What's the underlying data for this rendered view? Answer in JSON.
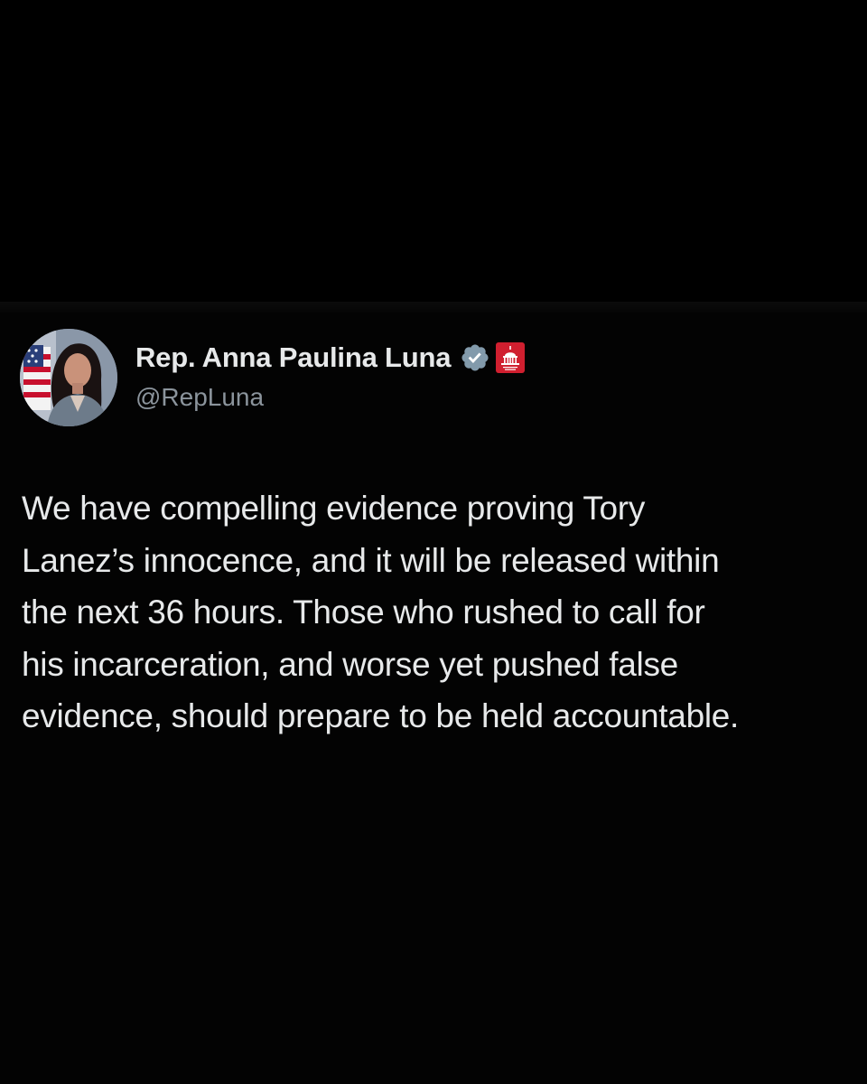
{
  "tweet": {
    "author": {
      "display_name": "Rep. Anna Paulina Luna",
      "handle": "@RepLuna",
      "verified_icon": "verified-badge-icon",
      "affiliation_icon": "capitol-icon",
      "avatar": "profile-photo"
    },
    "text": "We have compelling evidence proving Tory\nLanez’s innocence, and it will be released within\nthe next 36 hours. Those who rushed to call for\nhis incarceration, and worse yet pushed false\nevidence, should prepare to be held accountable."
  },
  "colors": {
    "background": "#000000",
    "text": "#e7e9ea",
    "handle": "#8b949c",
    "verified_badge": "#829aab",
    "affiliation_badge": "#d01f2f"
  }
}
